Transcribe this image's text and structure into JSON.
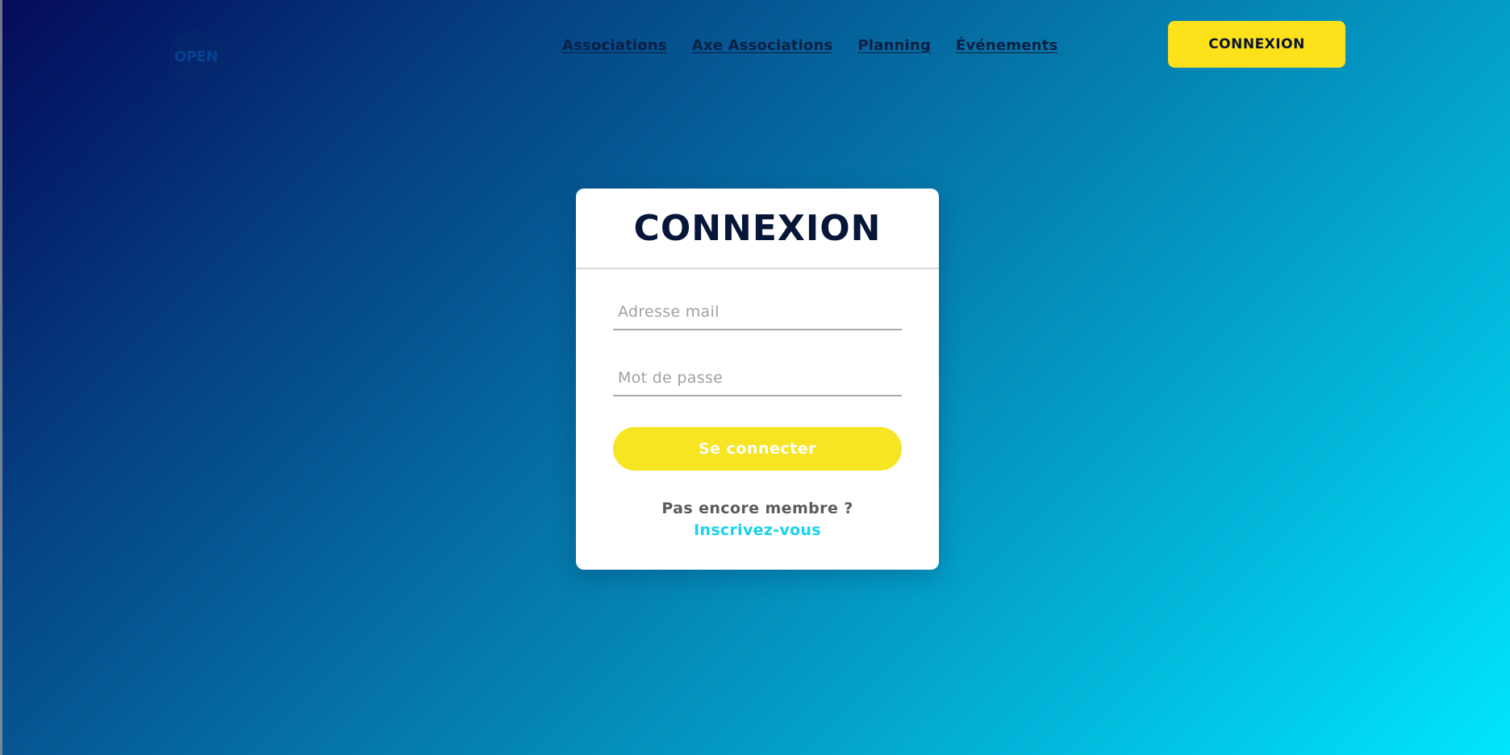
{
  "header": {
    "logo_text": "OPEN",
    "nav": [
      {
        "label": "Associations"
      },
      {
        "label": "Axe Associations"
      },
      {
        "label": "Planning"
      },
      {
        "label": "Événements"
      }
    ],
    "cta_label": "CONNEXION"
  },
  "login": {
    "title": "CONNEXION",
    "email_placeholder": "Adresse mail",
    "password_placeholder": "Mot de passe",
    "submit_label": "Se connecter",
    "signup_question": "Pas encore membre ?",
    "signup_link": "Inscrivez-vous"
  },
  "colors": {
    "accent_yellow": "#fde11a",
    "submit_yellow": "#f7e523",
    "link_cyan": "#16d4ec",
    "title_navy": "#061538",
    "gradient_start": "#040a5a",
    "gradient_end": "#00e6fc"
  }
}
